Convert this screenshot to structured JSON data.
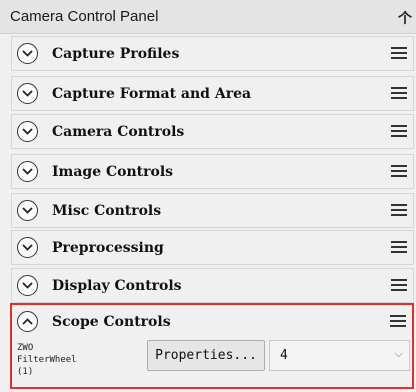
{
  "window": {
    "title": "Camera Control Panel",
    "pin_icon": "pin-icon"
  },
  "panels": [
    {
      "label": "Capture Profiles",
      "expanded": false
    },
    {
      "label": "Capture Format and Area",
      "expanded": false
    },
    {
      "label": "Camera Controls",
      "expanded": false
    },
    {
      "label": "Image Controls",
      "expanded": false
    },
    {
      "label": "Misc Controls",
      "expanded": false
    },
    {
      "label": "Preprocessing",
      "expanded": false
    },
    {
      "label": "Display Controls",
      "expanded": false
    },
    {
      "label": "Scope Controls",
      "expanded": true
    }
  ],
  "scope": {
    "filterwheel_label": "ZWO FilterWheel (1)",
    "properties_button": "Properties...",
    "filter_value": "4"
  },
  "colors": {
    "highlight": "#e03030"
  }
}
